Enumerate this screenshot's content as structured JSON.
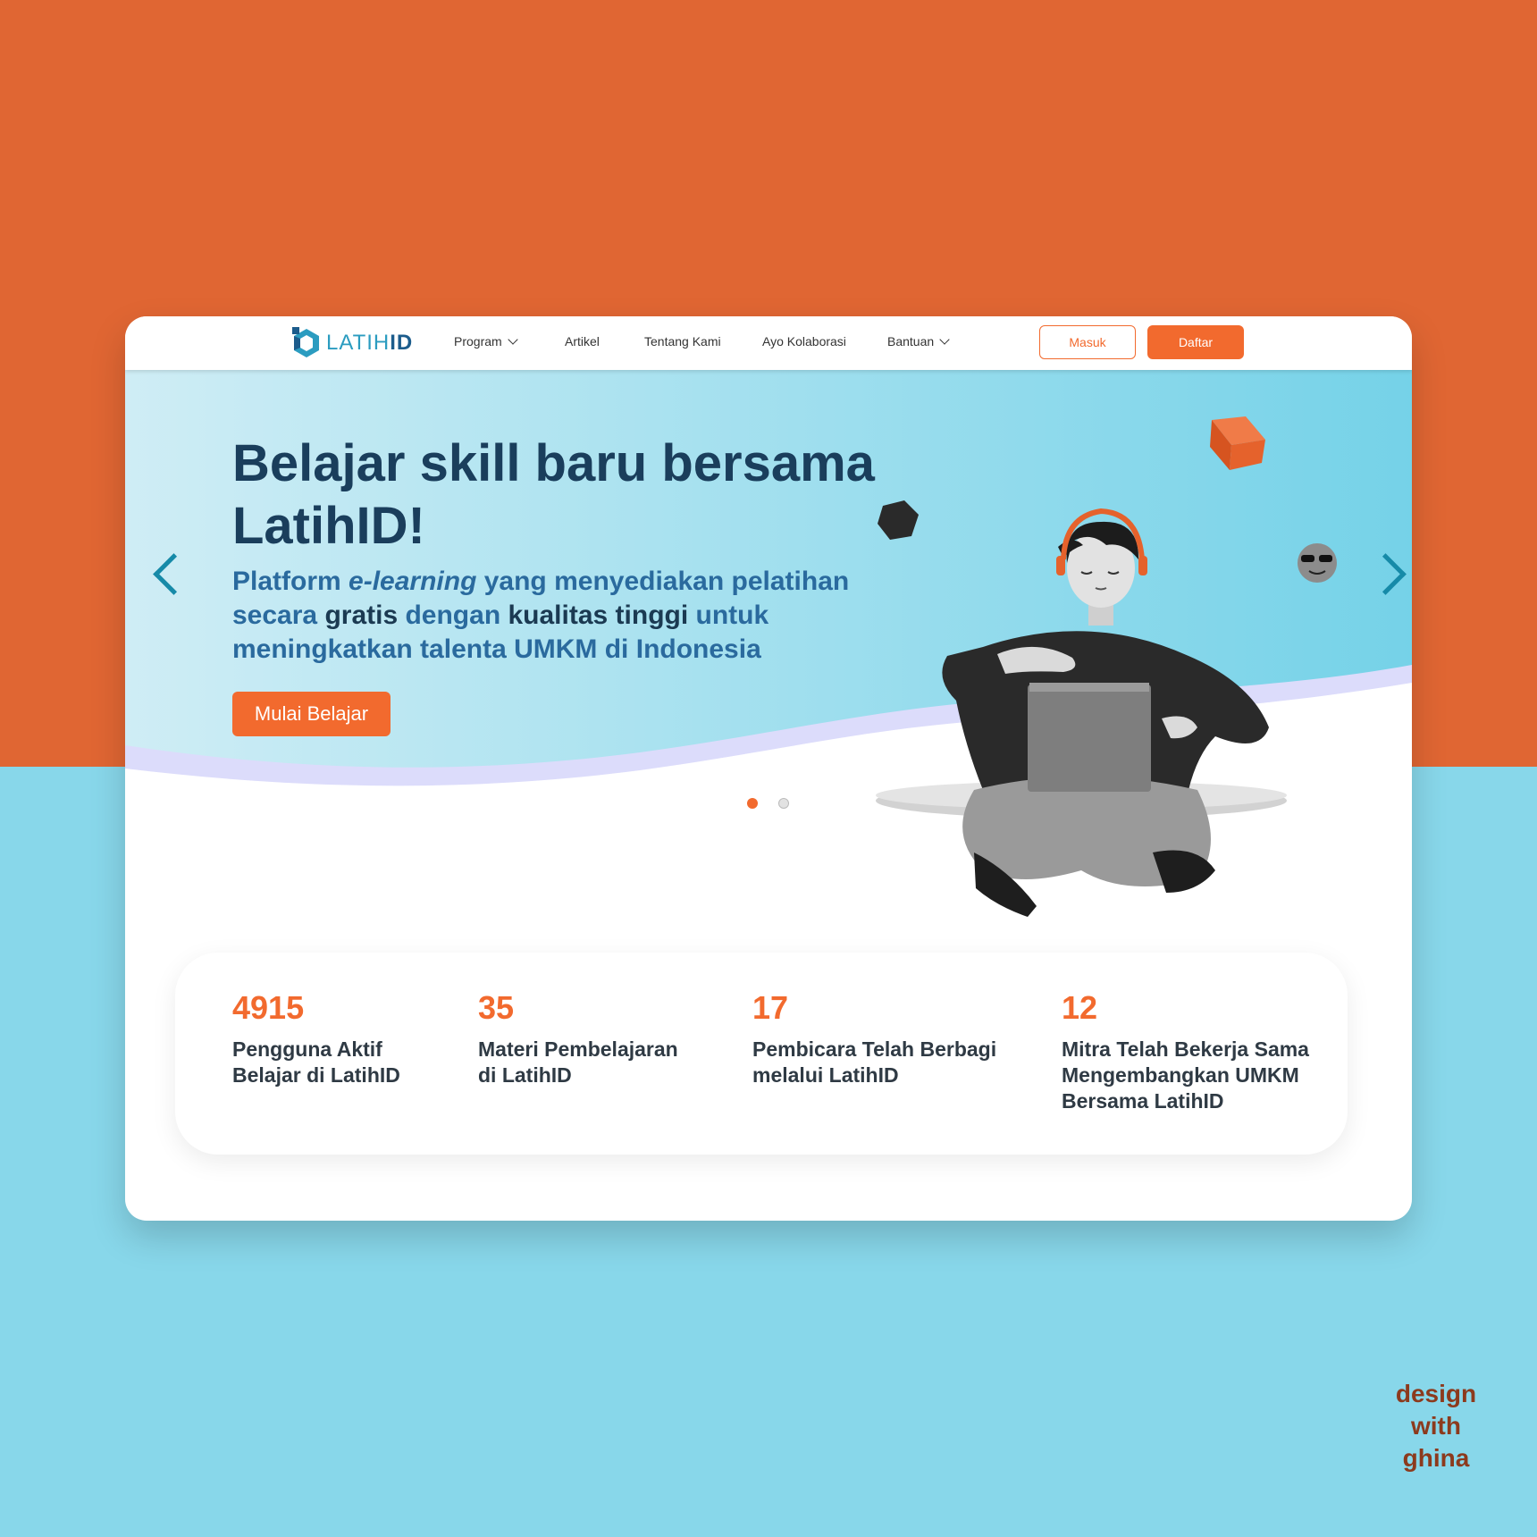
{
  "brand": {
    "logo_text_a": "LATIH",
    "logo_text_b": "ID",
    "color_primary": "#F26A2E",
    "color_navy": "#1A3E5C",
    "color_teal": "#2B9CC0"
  },
  "nav": {
    "items": [
      {
        "label": "Program",
        "dropdown": true
      },
      {
        "label": "Artikel",
        "dropdown": false
      },
      {
        "label": "Tentang Kami",
        "dropdown": false
      },
      {
        "label": "Ayo Kolaborasi",
        "dropdown": false
      },
      {
        "label": "Bantuan",
        "dropdown": true
      }
    ],
    "login_label": "Masuk",
    "register_label": "Daftar"
  },
  "hero": {
    "headline": "Belajar skill baru bersama LatihID!",
    "sub_1": "Platform ",
    "sub_2": "e-learning",
    "sub_3": " yang menyediakan pelatihan secara ",
    "sub_4": "gratis",
    "sub_5": " dengan ",
    "sub_6": "kualitas tinggi",
    "sub_7": " untuk meningkatkan talenta UMKM di Indonesia",
    "cta_label": "Mulai Belajar",
    "carousel": {
      "slides": 2,
      "active": 1
    }
  },
  "stats": [
    {
      "value": "4915",
      "label_1": "Pengguna Aktif",
      "label_2": "Belajar di LatihID",
      "label_3": ""
    },
    {
      "value": "35",
      "label_1": "Materi Pembelajaran",
      "label_2": "di LatihID",
      "label_3": ""
    },
    {
      "value": "17",
      "label_1": "Pembicara Telah Berbagi",
      "label_2": "melalui LatihID",
      "label_3": ""
    },
    {
      "value": "12",
      "label_1": "Mitra Telah Bekerja Sama",
      "label_2": "Mengembangkan UMKM",
      "label_3": "Bersama LatihID"
    }
  ],
  "watermark": {
    "line_1": "design",
    "line_2": "with",
    "line_3": "ghina"
  }
}
